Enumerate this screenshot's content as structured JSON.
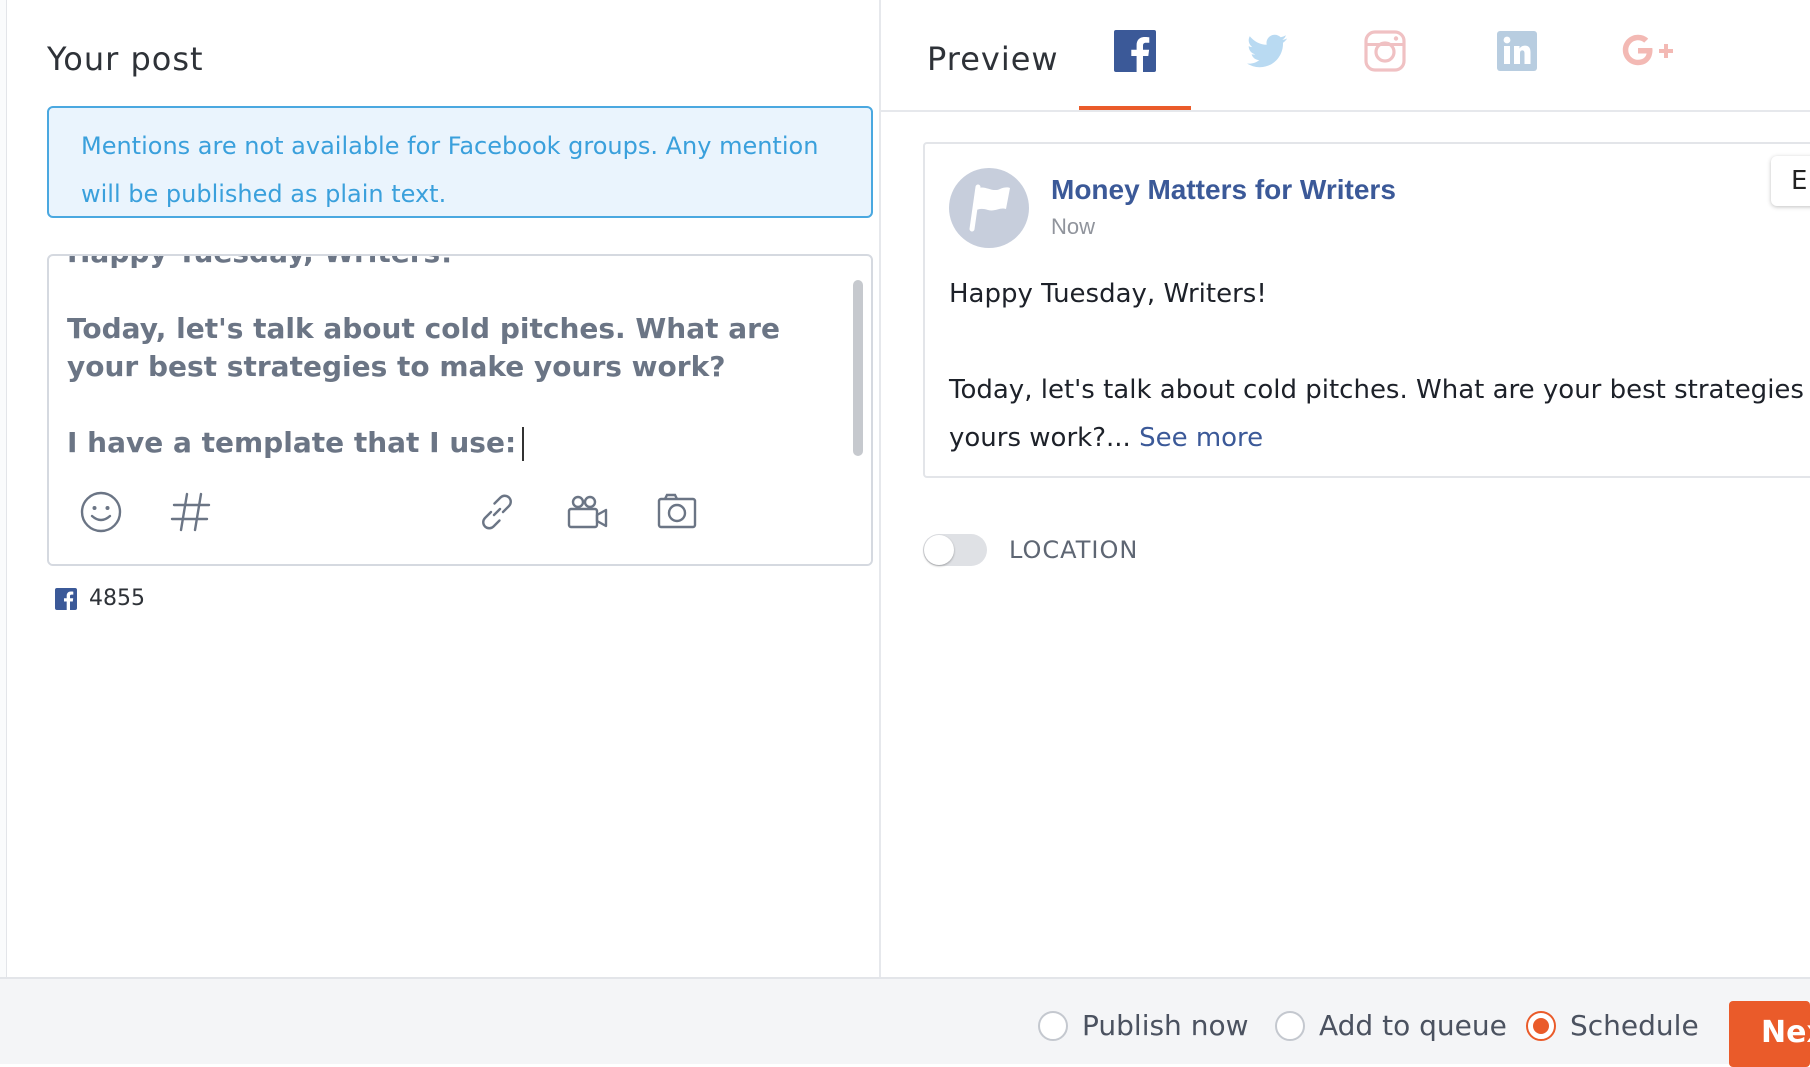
{
  "composer": {
    "title": "Your post",
    "notice": "Mentions are not available for Facebook groups. Any mention will be published as plain text.",
    "text": "Happy Tuesday, Writers!\n\nToday, let's talk about cold pitches. What are your best strategies to make yours work?\n\nI have a template that I use:",
    "toolbar": {
      "icons": [
        "emoji-icon",
        "hashtag-icon",
        "link-icon",
        "video-icon",
        "camera-icon"
      ]
    },
    "char_count": "4855"
  },
  "preview": {
    "title": "Preview",
    "networks": [
      "facebook",
      "twitter",
      "instagram",
      "linkedin",
      "google-plus"
    ],
    "active_network": "facebook",
    "card": {
      "page_name": "Money Matters for Writers",
      "time": "Now",
      "line1": "Happy Tuesday, Writers!",
      "line2": "Today, let's talk about cold pitches. What are your best strategies to ma",
      "line3": "yours work?...",
      "see_more": "See more",
      "edge_button": "E"
    },
    "location_label": "LOCATION",
    "location_enabled": false
  },
  "footer": {
    "options": [
      {
        "label": "Publish now",
        "selected": false
      },
      {
        "label": "Add to queue",
        "selected": false
      },
      {
        "label": "Schedule",
        "selected": true
      }
    ],
    "next_label": "Nex"
  },
  "colors": {
    "accent": "#ea5b2a",
    "facebook": "#3b5998",
    "notice_text": "#3aa0dc",
    "notice_bg": "#eaf4fd"
  }
}
